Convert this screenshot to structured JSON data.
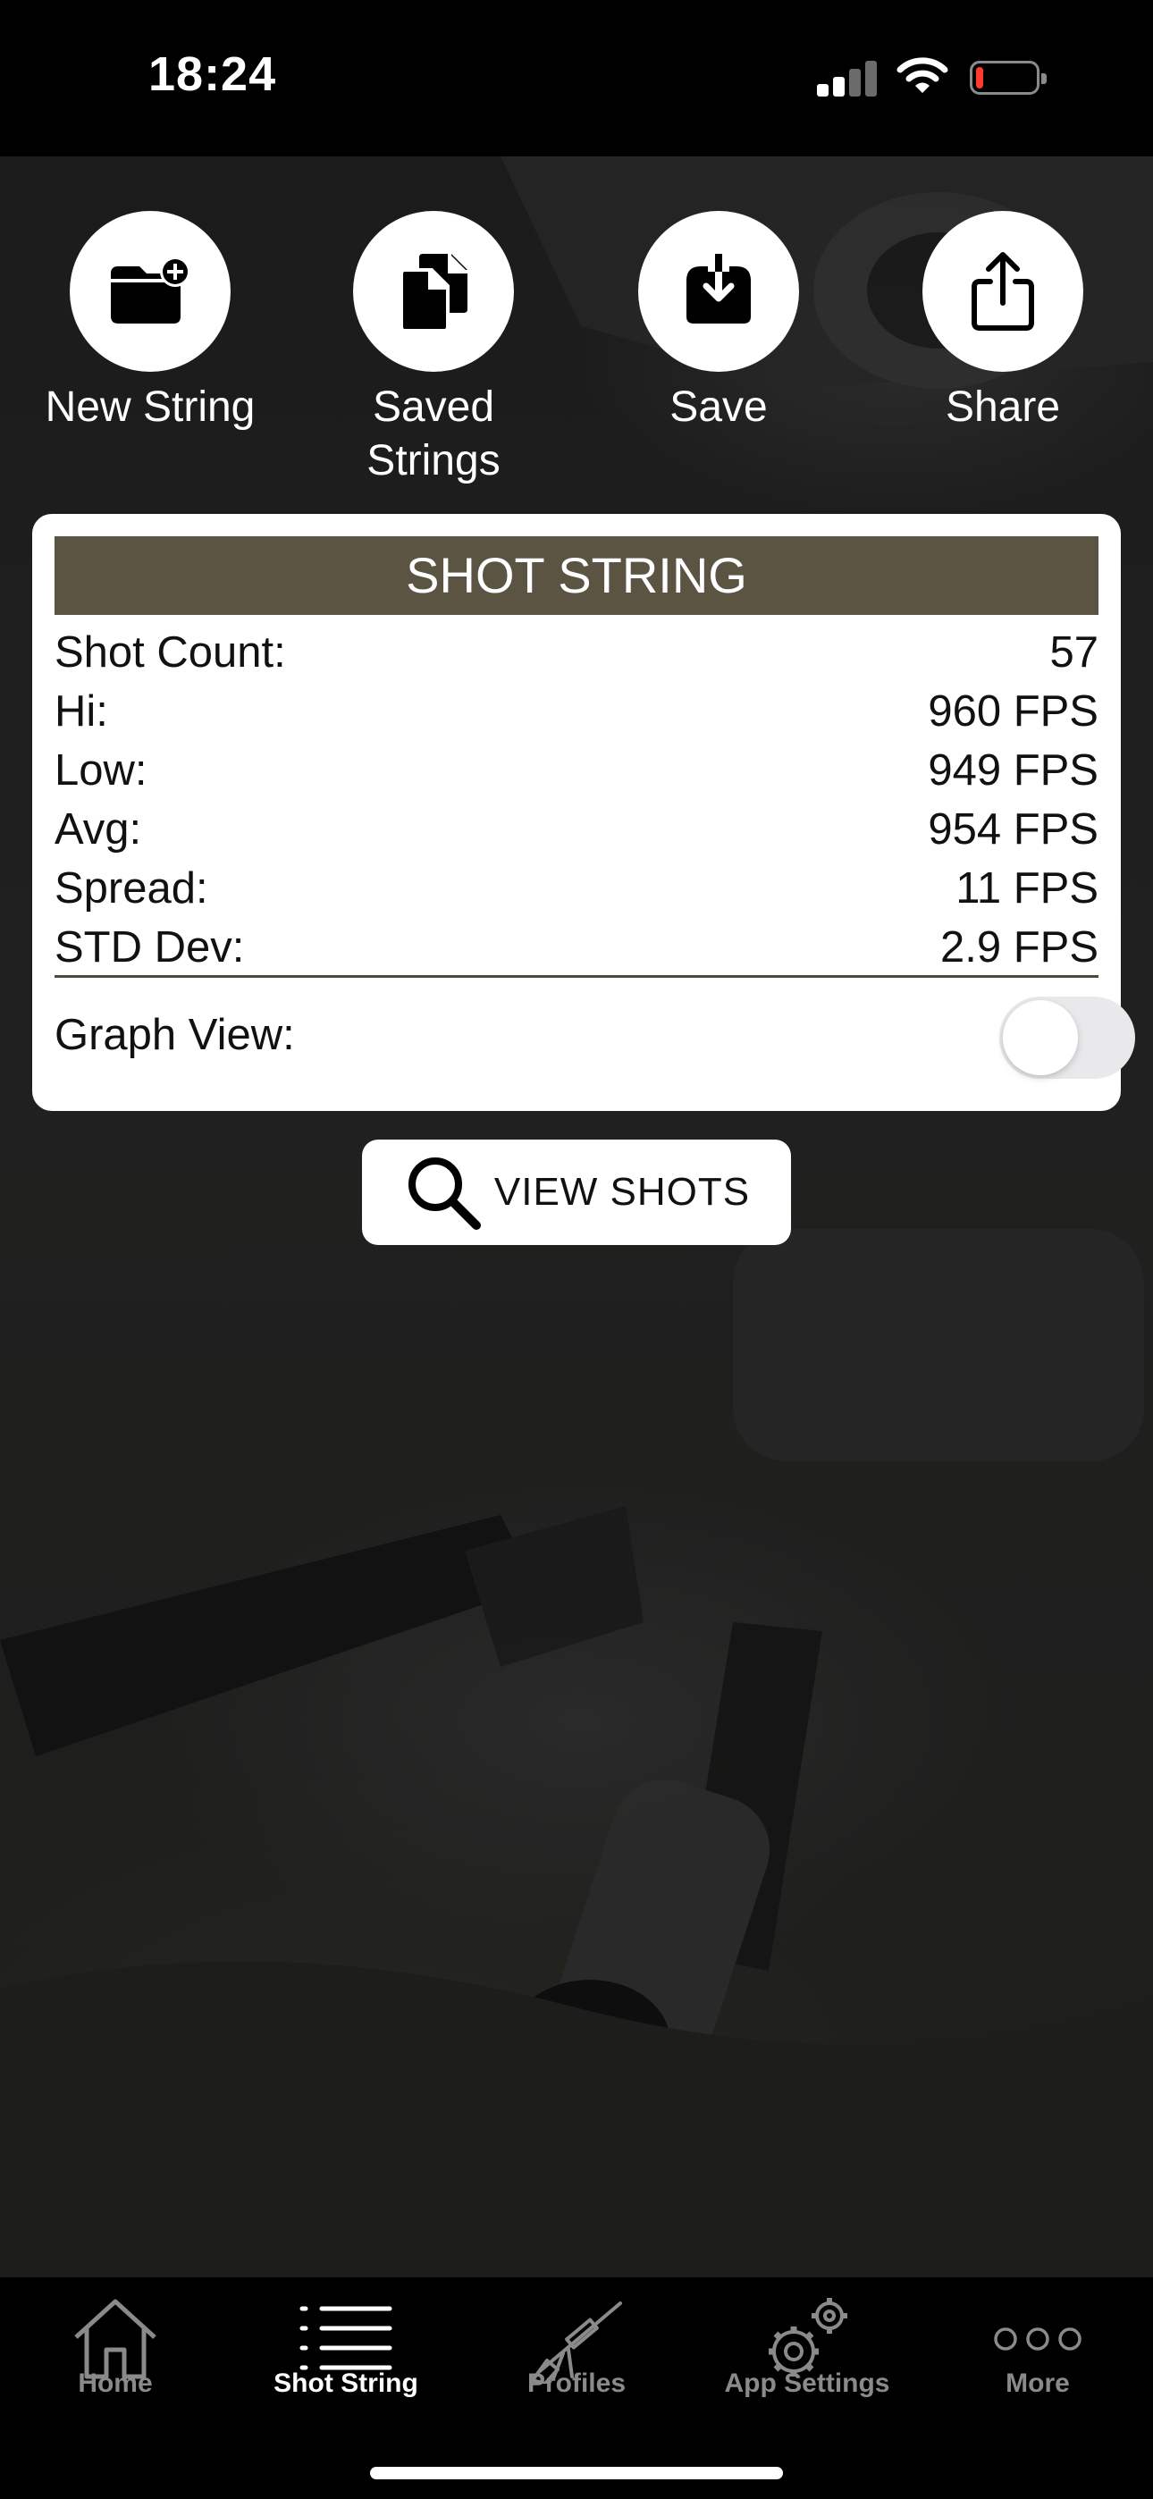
{
  "status_bar": {
    "time": "18:24"
  },
  "actions": [
    {
      "label": "New String",
      "icon": "folder-plus-icon"
    },
    {
      "label": "Saved Strings",
      "icon": "documents-icon"
    },
    {
      "label": "Save",
      "icon": "save-download-icon"
    },
    {
      "label": "Share",
      "icon": "share-icon"
    }
  ],
  "shot_string": {
    "title": "SHOT STRING",
    "rows": [
      {
        "label": "Shot Count:",
        "value": "57"
      },
      {
        "label": "Hi:",
        "value": "960 FPS"
      },
      {
        "label": "Low:",
        "value": "949 FPS"
      },
      {
        "label": "Avg:",
        "value": "954 FPS"
      },
      {
        "label": "Spread:",
        "value": "11 FPS"
      },
      {
        "label": "STD Dev:",
        "value": "2.9 FPS"
      }
    ],
    "graph_view_label": "Graph View:",
    "graph_view_on": false
  },
  "view_shots": {
    "label": "VIEW SHOTS",
    "icon": "search-icon"
  },
  "tabs": [
    {
      "label": "Home",
      "icon": "home-icon",
      "active": false
    },
    {
      "label": "Shot String",
      "icon": "list-icon",
      "active": true
    },
    {
      "label": "Profiles",
      "icon": "rifle-icon",
      "active": false
    },
    {
      "label": "App Settings",
      "icon": "gears-icon",
      "active": false
    },
    {
      "label": "More",
      "icon": "more-icon",
      "active": false
    }
  ],
  "colors": {
    "header": "#5c5443",
    "active_tab": "#ffffff",
    "inactive_tab": "#8a8a8a"
  }
}
